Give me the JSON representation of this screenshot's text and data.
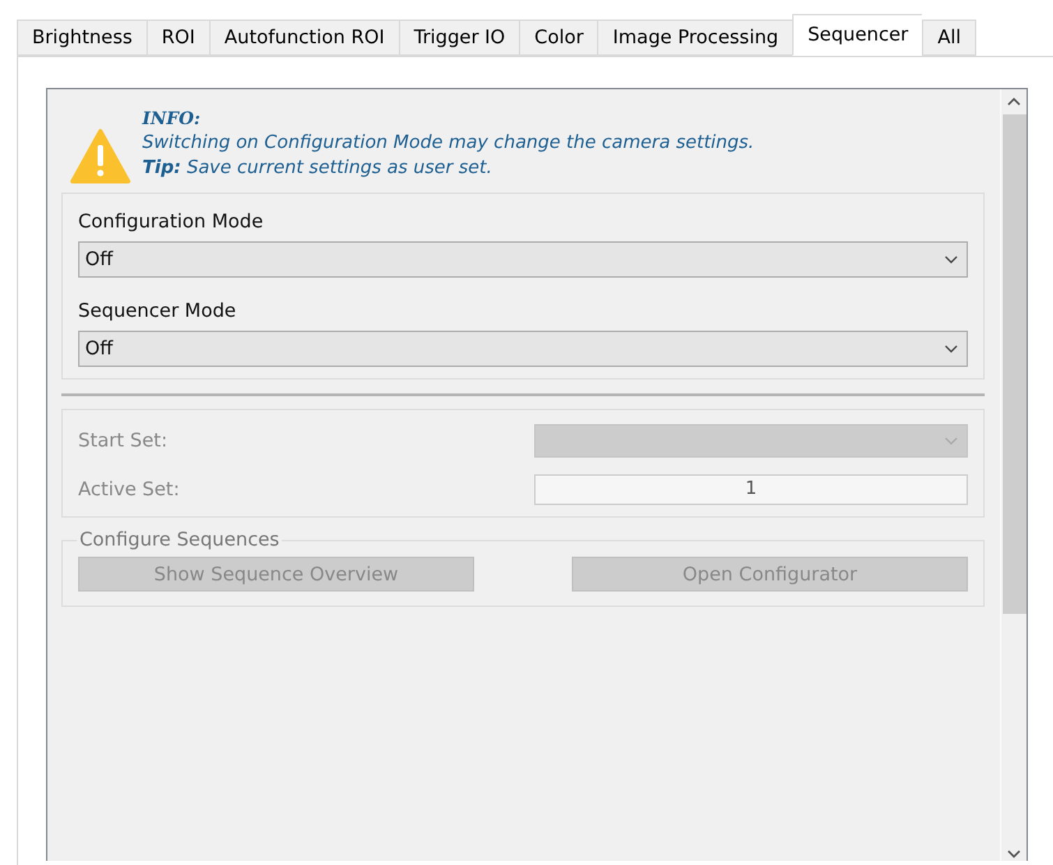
{
  "tabs": [
    {
      "label": "Brightness",
      "selected": false
    },
    {
      "label": "ROI",
      "selected": false
    },
    {
      "label": "Autofunction ROI",
      "selected": false
    },
    {
      "label": "Trigger IO",
      "selected": false
    },
    {
      "label": "Color",
      "selected": false
    },
    {
      "label": "Image Processing",
      "selected": false
    },
    {
      "label": "Sequencer",
      "selected": true
    },
    {
      "label": "All",
      "selected": false
    }
  ],
  "info": {
    "heading": "INFO:",
    "message": "Switching on Configuration Mode may change the camera settings.",
    "tip": "**Tip:** Save current settings as user set."
  },
  "modes": [
    {
      "label": "Configuration Mode",
      "value": "Off",
      "disabled": false
    },
    {
      "label": "Sequencer Mode",
      "value": "Off",
      "disabled": false
    }
  ],
  "sets": [
    {
      "kind": "dropdown",
      "label": "Start Set:",
      "disabled": true
    },
    {
      "kind": "number",
      "label": "Active Set:",
      "value": "1",
      "disabled": true
    }
  ],
  "configure": {
    "title": "Configure Sequences",
    "buttons": [
      {
        "label": "Show Sequence Overview",
        "disabled": true
      },
      {
        "label": "Open Configurator",
        "disabled": true
      }
    ]
  }
}
